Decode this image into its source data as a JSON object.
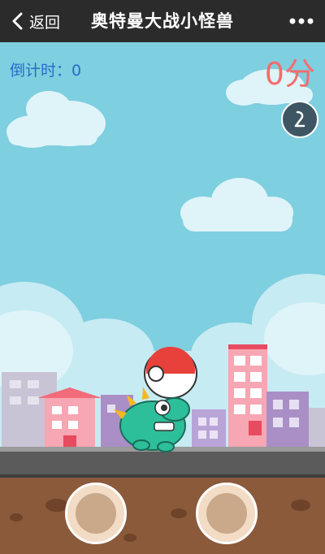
{
  "nav": {
    "back_label": "返回",
    "title": "奥特曼大战小怪兽",
    "more_icon": "more-dots-icon"
  },
  "hud": {
    "timer_label": "倒计时：",
    "timer_value": "0",
    "score_value": "0",
    "score_unit": "分",
    "sound_icon": "music-note-icon"
  },
  "controls": {
    "left_icon": "jump-pad",
    "right_icon": "jump-pad"
  },
  "colors": {
    "sky": "#7ecfe0",
    "score": "#f56c6c",
    "timer": "#2a6cc9",
    "ground": "#8a5a3b"
  }
}
